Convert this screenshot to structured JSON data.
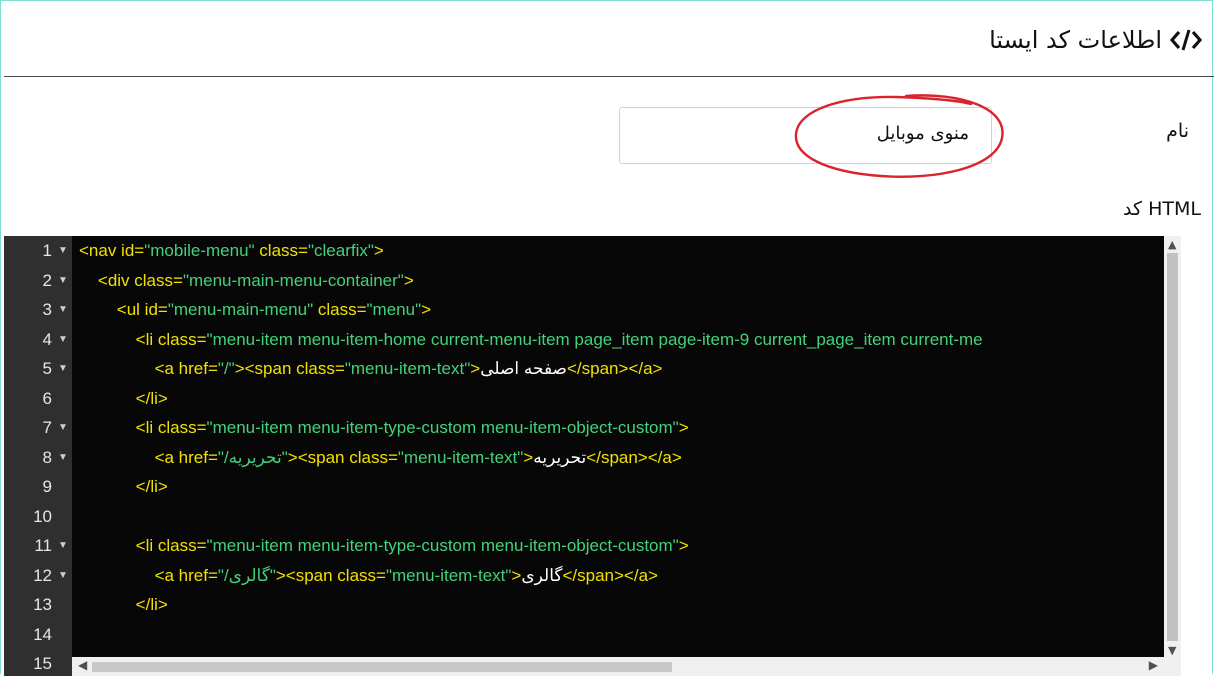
{
  "header": {
    "title": "اطلاعات کد ایستا",
    "icon": "code-icon"
  },
  "form": {
    "name_label": "نام",
    "name_value": "منوی موبایل",
    "html_label": "کد HTML"
  },
  "editor": {
    "lines": [
      {
        "n": "1",
        "fold": true,
        "parts": [
          [
            "t",
            "<nav id="
          ],
          [
            "s",
            "\"mobile-menu\""
          ],
          [
            "t",
            " class="
          ],
          [
            "s",
            "\"clearfix\""
          ],
          [
            "t",
            ">"
          ]
        ]
      },
      {
        "n": "2",
        "fold": true,
        "parts": [
          [
            "t",
            "    <div class="
          ],
          [
            "s",
            "\"menu-main-menu-container\""
          ],
          [
            "t",
            ">"
          ]
        ]
      },
      {
        "n": "3",
        "fold": true,
        "parts": [
          [
            "t",
            "        <ul id="
          ],
          [
            "s",
            "\"menu-main-menu\""
          ],
          [
            "t",
            " class="
          ],
          [
            "s",
            "\"menu\""
          ],
          [
            "t",
            ">"
          ]
        ]
      },
      {
        "n": "4",
        "fold": true,
        "parts": [
          [
            "t",
            "            <li class="
          ],
          [
            "s",
            "\"menu-item menu-item-home current-menu-item page_item page-item-9 current_page_item current-me"
          ]
        ]
      },
      {
        "n": "5",
        "fold": true,
        "parts": [
          [
            "t",
            "                <a href="
          ],
          [
            "s",
            "\"/\""
          ],
          [
            "t",
            "><span class="
          ],
          [
            "s",
            "\"menu-item-text\""
          ],
          [
            "t",
            ">"
          ],
          [
            "w",
            "صفحه اصلی"
          ],
          [
            "t",
            "</span></a>"
          ]
        ]
      },
      {
        "n": "6",
        "fold": false,
        "parts": [
          [
            "t",
            "            </li>"
          ]
        ]
      },
      {
        "n": "7",
        "fold": true,
        "parts": [
          [
            "t",
            "            <li class="
          ],
          [
            "s",
            "\"menu-item menu-item-type-custom menu-item-object-custom\""
          ],
          [
            "t",
            ">"
          ]
        ]
      },
      {
        "n": "8",
        "fold": true,
        "parts": [
          [
            "t",
            "                <a href="
          ],
          [
            "s",
            "\"/تحریریه\""
          ],
          [
            "t",
            "><span class="
          ],
          [
            "s",
            "\"menu-item-text\""
          ],
          [
            "t",
            ">"
          ],
          [
            "w",
            "تحریریه"
          ],
          [
            "t",
            "</span></a>"
          ]
        ]
      },
      {
        "n": "9",
        "fold": false,
        "parts": [
          [
            "t",
            "            </li>"
          ]
        ]
      },
      {
        "n": "10",
        "fold": false,
        "parts": []
      },
      {
        "n": "11",
        "fold": true,
        "parts": [
          [
            "t",
            "            <li class="
          ],
          [
            "s",
            "\"menu-item menu-item-type-custom menu-item-object-custom\""
          ],
          [
            "t",
            ">"
          ]
        ]
      },
      {
        "n": "12",
        "fold": true,
        "parts": [
          [
            "t",
            "                <a href="
          ],
          [
            "s",
            "\"/گالری\""
          ],
          [
            "t",
            "><span class="
          ],
          [
            "s",
            "\"menu-item-text\""
          ],
          [
            "t",
            ">"
          ],
          [
            "w",
            "گالری"
          ],
          [
            "t",
            "</span></a>"
          ]
        ]
      },
      {
        "n": "13",
        "fold": false,
        "parts": [
          [
            "t",
            "            </li>"
          ]
        ]
      },
      {
        "n": "14",
        "fold": false,
        "parts": []
      },
      {
        "n": "15",
        "fold": false,
        "parts": []
      }
    ]
  },
  "colors": {
    "tag": "#f2e100",
    "string": "#45d17b",
    "text": "#ffffff",
    "highlight": "#d9232d"
  }
}
